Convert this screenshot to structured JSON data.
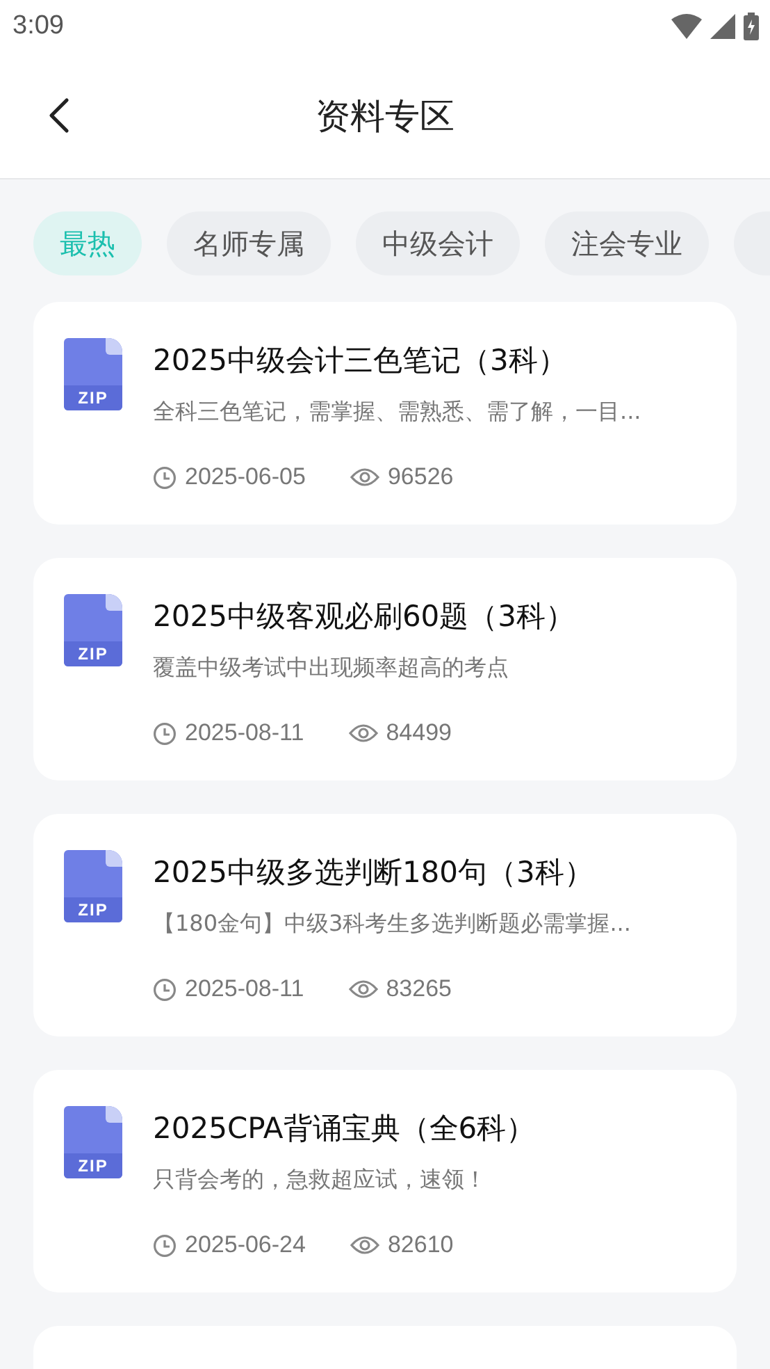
{
  "status_bar": {
    "time": "3:09"
  },
  "header": {
    "title": "资料专区"
  },
  "tabs": [
    {
      "label": "最热",
      "selected": true
    },
    {
      "label": "名师专属",
      "selected": false
    },
    {
      "label": "中级会计",
      "selected": false
    },
    {
      "label": "注会专业",
      "selected": false
    }
  ],
  "items": [
    {
      "file_type": "ZIP",
      "title": "2025中级会计三色笔记（3科）",
      "description": "全科三色笔记，需掌握、需熟悉、需了解，一目...",
      "date": "2025-06-05",
      "views": "96526"
    },
    {
      "file_type": "ZIP",
      "title": "2025中级客观必刷60题（3科）",
      "description": "覆盖中级考试中出现频率超高的考点",
      "date": "2025-08-11",
      "views": "84499"
    },
    {
      "file_type": "ZIP",
      "title": "2025中级多选判断180句（3科）",
      "description": "【180金句】中级3科考生多选判断题必需掌握...",
      "date": "2025-08-11",
      "views": "83265"
    },
    {
      "file_type": "ZIP",
      "title": "2025CPA背诵宝典（全6科）",
      "description": "只背会考的，急救超应试，速领！",
      "date": "2025-06-24",
      "views": "82610"
    }
  ]
}
